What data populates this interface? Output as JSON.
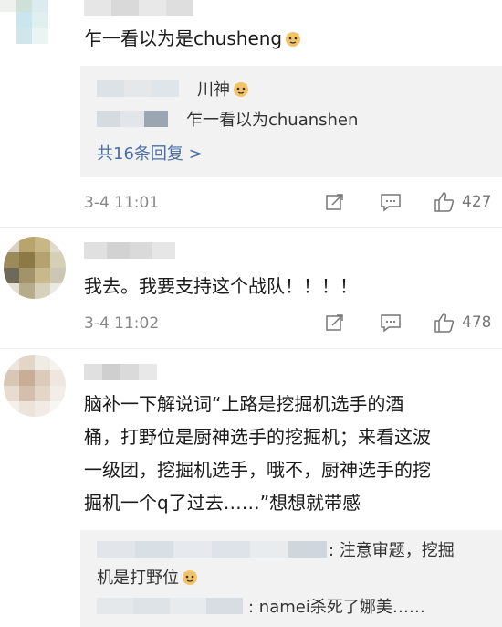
{
  "comments": [
    {
      "text": "乍一看以为是chusheng",
      "replies": [
        {
          "text": "川神"
        },
        {
          "text": "乍一看以为chuanshen"
        }
      ],
      "more_replies": "共16条回复 >",
      "time": "3-4 11:01",
      "likes": "427"
    },
    {
      "text": "我去。我要支持这个战队！！！！",
      "time": "3-4 11:02",
      "likes": "478"
    },
    {
      "text_lines": [
        "脑补一下解说词“上路是挖掘机选手的酒",
        "桶，打野位是厨神选手的挖掘机；来看这波",
        "一级团，挖掘机选手，哦不，厨神选手的挖",
        "掘机一个q了过去……”想想就带感"
      ],
      "replies": [
        {
          "text": ": 注意审题，挖掘"
        },
        {
          "text": "机是打野位"
        },
        {
          "text": ": namei杀死了娜美……"
        }
      ]
    }
  ],
  "icons": [
    "share-icon",
    "comment-icon",
    "like-icon",
    "emoji-face-icon"
  ],
  "colors": {
    "link": "#4a6fa5",
    "meta": "#888888",
    "reply_bg": "#f2f2f2"
  }
}
